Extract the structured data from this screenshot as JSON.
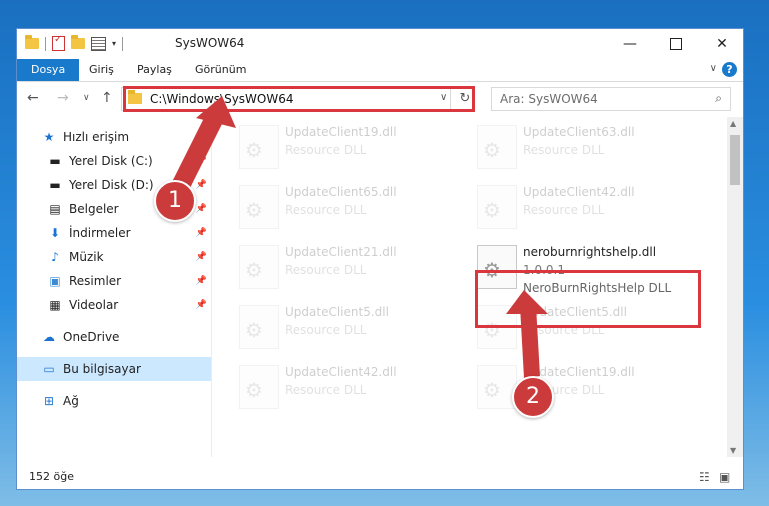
{
  "window": {
    "title": "SysWOW64",
    "controls": {
      "minimize": "—",
      "maximize": "",
      "close": "✕"
    }
  },
  "ribbon": {
    "tabs": [
      "Dosya",
      "Giriş",
      "Paylaş",
      "Görünüm"
    ]
  },
  "address": {
    "path": "C:\\Windows\\SysWOW64"
  },
  "search": {
    "placeholder": "Ara: SysWOW64"
  },
  "sidebar": {
    "items": [
      {
        "label": "Hızlı erişim",
        "icon": "star-icon"
      },
      {
        "label": "Yerel Disk (C:)",
        "icon": "drive-icon"
      },
      {
        "label": "Yerel Disk (D:)",
        "icon": "drive-icon"
      },
      {
        "label": "Belgeler",
        "icon": "document-icon"
      },
      {
        "label": "İndirmeler",
        "icon": "download-icon"
      },
      {
        "label": "Müzik",
        "icon": "music-icon"
      },
      {
        "label": "Resimler",
        "icon": "pictures-icon"
      },
      {
        "label": "Videolar",
        "icon": "video-icon"
      },
      {
        "label": "OneDrive",
        "icon": "cloud-icon"
      },
      {
        "label": "Bu bilgisayar",
        "icon": "computer-icon"
      },
      {
        "label": "Ağ",
        "icon": "network-icon"
      }
    ]
  },
  "files": {
    "col1": [
      {
        "name": "UpdateClient19.dll",
        "desc": "Resource DLL"
      },
      {
        "name": "UpdateClient65.dll",
        "desc": "Resource DLL"
      },
      {
        "name": "UpdateClient21.dll",
        "desc": "Resource DLL"
      },
      {
        "name": "UpdateClient5.dll",
        "desc": "Resource DLL"
      },
      {
        "name": "UpdateClient42.dll",
        "desc": "Resource DLL"
      }
    ],
    "col2": [
      {
        "name": "UpdateClient63.dll",
        "desc": "Resource DLL"
      },
      {
        "name": "UpdateClient42.dll",
        "desc": "Resource DLL"
      },
      {
        "name": "UpdateClient5.dll",
        "desc": "Resource DLL"
      },
      {
        "name": "UpdateClient19.dll",
        "desc": "Resource DLL"
      }
    ],
    "highlighted": {
      "name": "neroburnrightshelp.dll",
      "version": "1.0.0.1",
      "desc": "NeroBurnRightsHelp DLL"
    }
  },
  "status": {
    "count": "152 öğe"
  },
  "callouts": {
    "one": "1",
    "two": "2"
  },
  "colors": {
    "accent": "#1979ca",
    "highlight": "#d9363e",
    "callout": "#cc3b3b"
  }
}
